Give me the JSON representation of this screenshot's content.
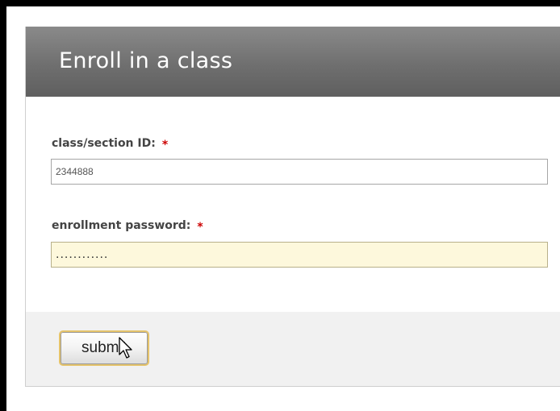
{
  "form": {
    "title": "Enroll in a class",
    "required_marker": "*",
    "class_id": {
      "label": "class/section ID:",
      "value": "2344888"
    },
    "enroll_password": {
      "label": "enrollment password:",
      "value": "............"
    },
    "submit_label": "submit"
  }
}
